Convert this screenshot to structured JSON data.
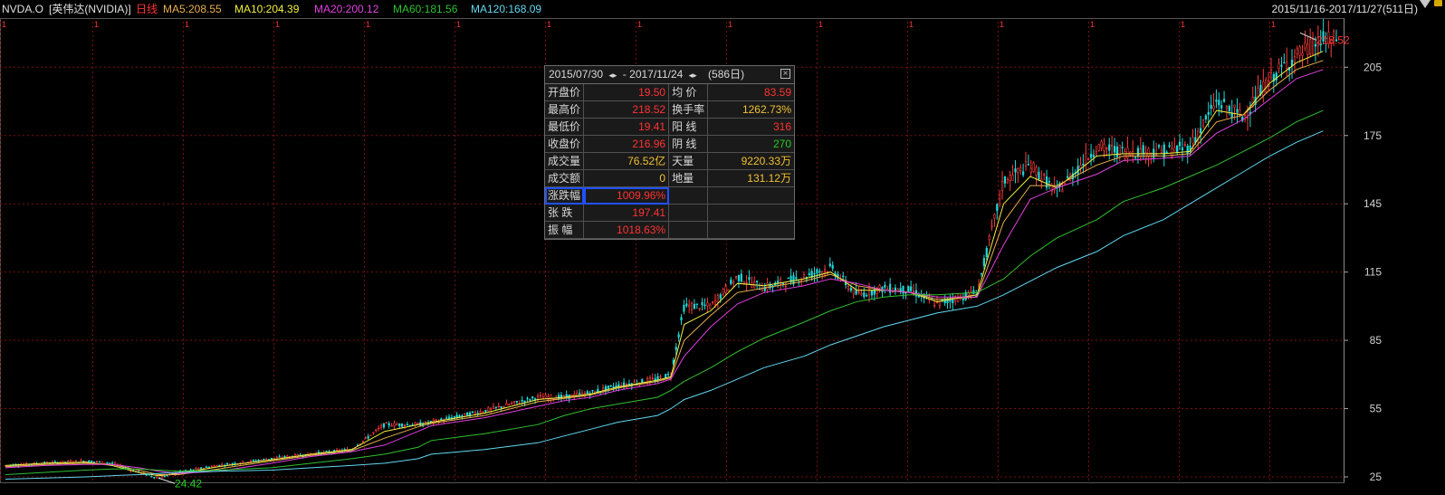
{
  "header": {
    "symbol": "NVDA.O",
    "name": "[英伟达(NVIDIA)]",
    "period": "日线",
    "ma": [
      {
        "label": "MA5:208.55",
        "color": "#e8b050"
      },
      {
        "label": "MA10:204.39",
        "color": "#f0f040"
      },
      {
        "label": "MA20:200.12",
        "color": "#e040e0"
      },
      {
        "label": "MA60:181.56",
        "color": "#30c030"
      },
      {
        "label": "MA120:168.09",
        "color": "#60d8f0"
      }
    ],
    "range": "2015/11/16-2017/11/27(511日)"
  },
  "stats": {
    "range_start": "2015/07/30",
    "range_end": "2017/11/24",
    "arrow": "◂▸",
    "dash": "-",
    "days": "(586日)",
    "rows": [
      [
        {
          "l": "开盘价",
          "v": "19.50",
          "c": "red"
        },
        {
          "l": "均  价",
          "v": "83.59",
          "c": "red"
        }
      ],
      [
        {
          "l": "最高价",
          "v": "218.52",
          "c": "red"
        },
        {
          "l": "换手率",
          "v": "1262.73%",
          "c": "yellow"
        }
      ],
      [
        {
          "l": "最低价",
          "v": "19.41",
          "c": "red"
        },
        {
          "l": "阳  线",
          "v": "316",
          "c": "red"
        }
      ],
      [
        {
          "l": "收盘价",
          "v": "216.96",
          "c": "red"
        },
        {
          "l": "阴  线",
          "v": "270",
          "c": "green"
        }
      ],
      [
        {
          "l": "成交量",
          "v": "76.52亿",
          "c": "yellow"
        },
        {
          "l": "天量",
          "v": "9220.33万",
          "c": "yellow"
        }
      ],
      [
        {
          "l": "成交额",
          "v": "0",
          "c": "yellow"
        },
        {
          "l": "地量",
          "v": "131.12万",
          "c": "yellow"
        }
      ],
      [
        {
          "l": "涨跌幅",
          "v": "1009.96%",
          "c": "red",
          "sel": true
        },
        {
          "l": "",
          "v": "",
          "c": "white"
        }
      ],
      [
        {
          "l": "张  跌",
          "v": "197.41",
          "c": "red"
        },
        {
          "l": "",
          "v": "",
          "c": "white"
        }
      ],
      [
        {
          "l": "振  幅",
          "v": "1018.63%",
          "c": "red"
        },
        {
          "l": "",
          "v": "",
          "c": "white"
        }
      ]
    ]
  },
  "chart_data": {
    "type": "line",
    "title": "NVDA.O [英伟达(NVIDIA)] 日线",
    "ylim": [
      25,
      225
    ],
    "y_ticks": [
      "205",
      "175",
      "145",
      "115",
      "85",
      "55",
      "25"
    ],
    "y_tick_values": [
      205,
      175,
      145,
      115,
      85,
      55,
      25
    ],
    "x_start": "2015/11/16",
    "x_end": "2017/11/27",
    "grid": true,
    "high_label": "218.52",
    "low_label": "24.42",
    "price_anchor_points": [
      [
        0,
        30
      ],
      [
        0.03,
        31
      ],
      [
        0.06,
        32
      ],
      [
        0.08,
        31
      ],
      [
        0.1,
        27
      ],
      [
        0.115,
        24.5
      ],
      [
        0.13,
        27
      ],
      [
        0.16,
        30
      ],
      [
        0.2,
        33
      ],
      [
        0.23,
        35
      ],
      [
        0.26,
        37
      ],
      [
        0.285,
        48
      ],
      [
        0.31,
        48
      ],
      [
        0.32,
        49
      ],
      [
        0.36,
        54
      ],
      [
        0.4,
        60
      ],
      [
        0.42,
        60
      ],
      [
        0.44,
        62
      ],
      [
        0.46,
        65
      ],
      [
        0.49,
        68
      ],
      [
        0.5,
        70
      ],
      [
        0.51,
        100
      ],
      [
        0.53,
        100
      ],
      [
        0.55,
        113
      ],
      [
        0.57,
        108
      ],
      [
        0.6,
        113
      ],
      [
        0.62,
        117
      ],
      [
        0.64,
        105
      ],
      [
        0.66,
        108
      ],
      [
        0.68,
        107
      ],
      [
        0.7,
        101
      ],
      [
        0.73,
        106
      ],
      [
        0.75,
        155
      ],
      [
        0.77,
        162
      ],
      [
        0.79,
        150
      ],
      [
        0.82,
        170
      ],
      [
        0.84,
        168
      ],
      [
        0.87,
        168
      ],
      [
        0.89,
        170
      ],
      [
        0.91,
        190
      ],
      [
        0.93,
        183
      ],
      [
        0.95,
        200
      ],
      [
        0.97,
        210
      ],
      [
        0.99,
        217
      ]
    ],
    "series": [
      {
        "name": "MA5",
        "values": [
          30,
          31,
          31.5,
          30,
          27,
          25.5,
          26.5,
          29.5,
          32.5,
          35,
          37,
          45,
          48,
          49,
          53,
          59,
          60,
          61.5,
          64.5,
          67.5,
          69,
          92,
          98,
          110,
          109,
          112,
          115,
          107,
          107,
          106,
          102,
          105,
          145,
          157,
          152,
          166,
          167,
          167,
          168,
          186,
          184,
          198,
          207,
          212
        ],
        "color": "#f0f040"
      },
      {
        "name": "MA10",
        "values": [
          29.5,
          30.5,
          31,
          30.5,
          28,
          26,
          26,
          28.5,
          32,
          34.5,
          36.5,
          42,
          47,
          48.5,
          52,
          58,
          59.5,
          61,
          64,
          67,
          68.5,
          85,
          96,
          106,
          108,
          111,
          114,
          109,
          107,
          106,
          103,
          104,
          137,
          153,
          153,
          162,
          166,
          166,
          167,
          181,
          184,
          195,
          204,
          208
        ],
        "color": "#e8b050"
      },
      {
        "name": "MA20",
        "values": [
          29,
          30,
          30.5,
          30.5,
          29,
          27.5,
          26.5,
          27.5,
          31,
          34,
          36,
          39,
          45,
          47.5,
          51,
          56,
          58.5,
          60,
          63,
          66,
          68,
          78,
          91,
          101,
          106,
          109,
          112,
          110,
          107,
          106,
          104,
          104,
          127,
          147,
          152,
          158,
          164,
          165,
          166,
          176,
          182,
          191,
          200,
          204
        ],
        "color": "#e040e0"
      },
      {
        "name": "MA60",
        "values": [
          26,
          27,
          28,
          28.5,
          28.5,
          28,
          27.5,
          28,
          29,
          31,
          33,
          35,
          38,
          41,
          44,
          48,
          52,
          55,
          57,
          60,
          63,
          67,
          73,
          80,
          86,
          93,
          98,
          102,
          104,
          105,
          105,
          106,
          112,
          122,
          130,
          138,
          146,
          152,
          157,
          162,
          168,
          174,
          181,
          186
        ],
        "color": "#30c030"
      },
      {
        "name": "MA120",
        "values": [
          24,
          24.5,
          25,
          25.5,
          26,
          26.5,
          27,
          27.5,
          28,
          29,
          30,
          31,
          33,
          35,
          37,
          40,
          43,
          46,
          49,
          52,
          55,
          59,
          63,
          68,
          73,
          78,
          83,
          87,
          91,
          94,
          97,
          100,
          105,
          111,
          117,
          124,
          131,
          138,
          145,
          152,
          159,
          166,
          172,
          177
        ],
        "color": "#60d8f0"
      }
    ]
  }
}
